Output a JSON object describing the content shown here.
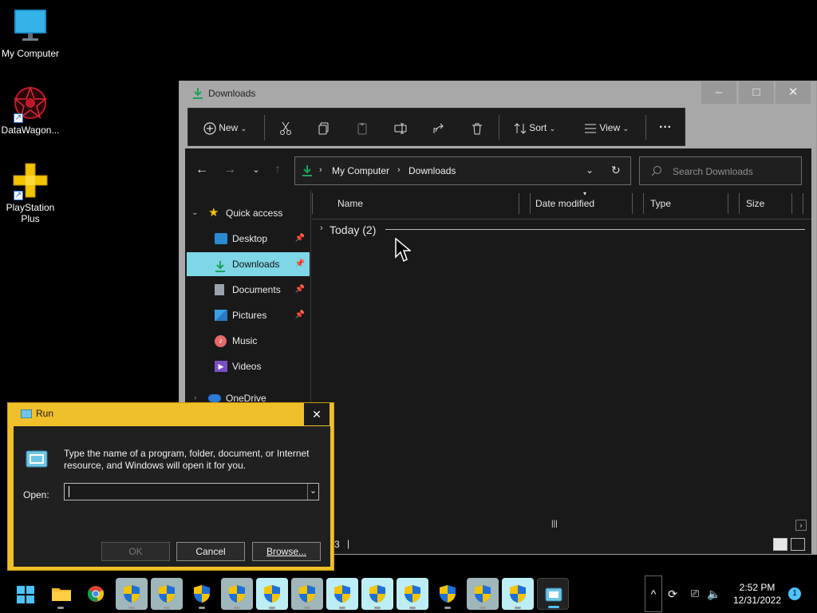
{
  "desktop": {
    "icons": [
      {
        "label": "My Computer"
      },
      {
        "label": "DataWagon..."
      },
      {
        "label": "PlayStation Plus"
      }
    ]
  },
  "explorer": {
    "title": "Downloads",
    "toolbar": {
      "new_label": "New",
      "sort_label": "Sort",
      "view_label": "View",
      "more_label": "···"
    },
    "breadcrumb": [
      "My Computer",
      "Downloads"
    ],
    "search_placeholder": "Search Downloads",
    "nav": {
      "quick_access": "Quick access",
      "items": [
        {
          "label": "Desktop",
          "pinned": true
        },
        {
          "label": "Downloads",
          "pinned": true,
          "selected": true
        },
        {
          "label": "Documents",
          "pinned": true
        },
        {
          "label": "Pictures",
          "pinned": true
        },
        {
          "label": "Music",
          "pinned": false
        },
        {
          "label": "Videos",
          "pinned": false
        }
      ],
      "onedrive": "OneDrive"
    },
    "columns": [
      "Name",
      "Date modified",
      "Type",
      "Size"
    ],
    "group_label": "Today (2)",
    "status_text": "3"
  },
  "run": {
    "title": "Run",
    "description": "Type the name of a program, folder, document, or Internet resource, and Windows will open it for you.",
    "open_label": "Open:",
    "open_value": "",
    "ok_label": "OK",
    "cancel_label": "Cancel",
    "browse_label": "Browse..."
  },
  "taskbar": {
    "time": "2:52 PM",
    "date": "12/31/2022",
    "notification_count": "1"
  },
  "colors": {
    "accent_blue": "#0078d4",
    "selected_nav": "#7fd6e6",
    "run_frame": "#f0c02a",
    "shield_yellow": "#f5c400"
  }
}
